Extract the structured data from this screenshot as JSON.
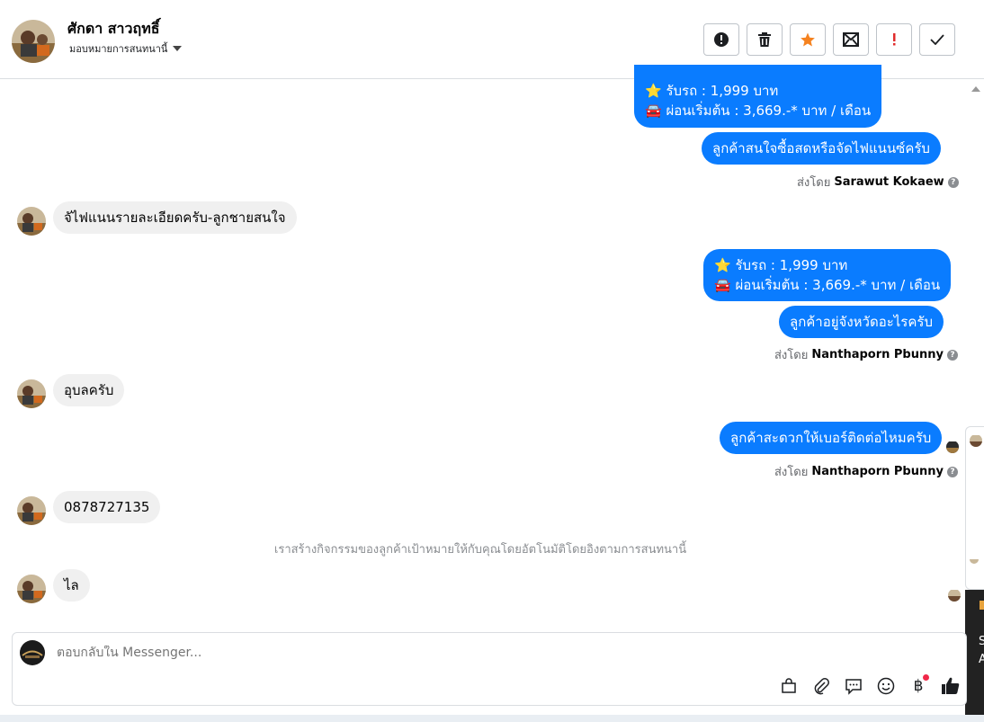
{
  "header": {
    "contact_name": "ศักดา สาวฤทธิ์",
    "assign_label": "มอบหมายการสนทนานี้"
  },
  "actions": [
    {
      "name": "spam-icon"
    },
    {
      "name": "trash-icon"
    },
    {
      "name": "star-icon"
    },
    {
      "name": "mark-unread-icon"
    },
    {
      "name": "important-icon"
    },
    {
      "name": "done-check-icon"
    }
  ],
  "conversation": {
    "m1_line1": "⭐ รับรถ : 1,999 บาท",
    "m1_line2": "🚘 ผ่อนเริ่มต้น : 3,669.-* บาท / เดือน",
    "m2": "ลูกค้าสนใจซื้อสดหรือจัดไฟแนนซ์ครับ",
    "sent1_prefix": "ส่งโดย",
    "sent1_name": "Sarawut Kokaew",
    "m3": "จัไฟแนนรายละเอียดครับ-ลูกชายสนใจ",
    "m4_line1": "⭐ รับรถ : 1,999 บาท",
    "m4_line2": "🚘 ผ่อนเริ่มต้น : 3,669.-* บาท / เดือน",
    "m5": "ลูกค้าอยู่จังหวัดอะไรครับ",
    "sent2_prefix": "ส่งโดย",
    "sent2_name": "Nanthaporn Pbunny",
    "m6": "อุบลครับ",
    "m7": "ลูกค้าสะดวกให้เบอร์ติดต่อไหมครับ",
    "sent3_prefix": "ส่งโดย",
    "sent3_name": "Nanthaporn Pbunny",
    "m8": "0878727135",
    "system_note": "เราสร้างกิจกรรมของลูกค้าเป้าหมายให้กับคุณโดยอัตโนมัติโดยอิงตามการสนทนานี้",
    "m9": "ไล"
  },
  "side_panel": {
    "dark_text_1": "S",
    "dark_text_2": "A"
  },
  "composer": {
    "placeholder": "ตอบกลับใน Messenger..."
  },
  "colors": {
    "outgoing_bubble": "#0a7cff",
    "incoming_bubble": "#f0f0f0",
    "star_orange": "#f5821f",
    "important_red": "#e02c2c"
  }
}
